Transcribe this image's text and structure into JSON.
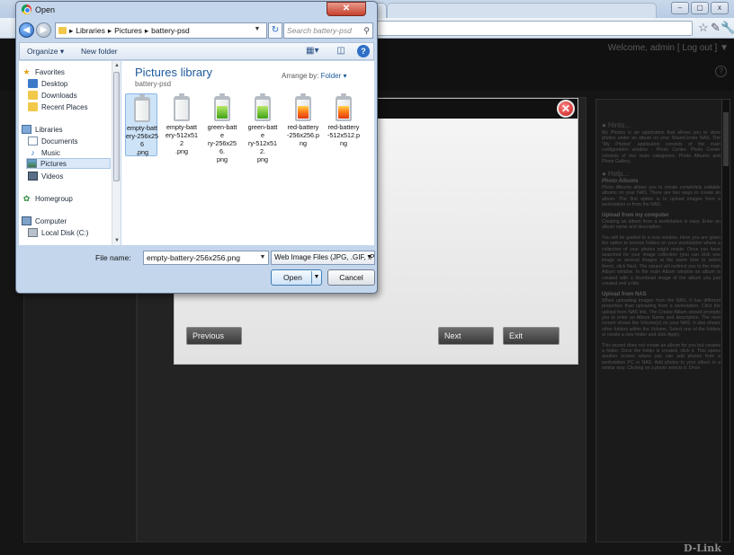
{
  "browser": {
    "welcome": "Welcome, admin [ Log out ] ▼",
    "star_icon": "☆",
    "wrench_icon": "🔧",
    "pencil_icon": "✎",
    "help_icon": "?"
  },
  "wizard": {
    "previous_label": "Previous",
    "next_label": "Next",
    "exit_label": "Exit",
    "close_icon": "✕"
  },
  "hints": {
    "hints_title": "● Hints...",
    "hints_text": "My Photos is an application that allows you to store photos under an album on your ShareCenter NAS. The \"My Photos\" application consists of the main configuration window - Photo Center. Photo Center consists of two main categories: Photo Albums and Photo Gallery.",
    "help_title": "● Help...",
    "albums_title": "Photo Albums",
    "albums_text": "Photo Albums allows you to create completely editable albums on your NAS. There are two ways to create an album. The first option is to upload images from a workstation or from the NAS.",
    "upload_pc_title": "Upload from my computer",
    "upload_pc_text": "Creating an album from a workstation is easy. Enter an album name and description.",
    "guide_text": "You will be guided to a new window. Here you are given the option to browse folders on your workstation where a collection of your photos might reside. Once you have searched for your image collection (you can click one image or several images at the same time to select them), click Next. The wizard will redirect you to the main Album window. In the main Album window an album is created with a thumbnail image of the album you just created and a title.",
    "upload_nas_title": "Upload from NAS",
    "upload_nas_text": "When uploading images from the NAS, it has different properties than uploading from a workstation. Click the upload from NAS link. The Create Album wizard prompts you to enter an Album Name and description. The next screen shows the Volume(s) on your NAS. It also shows other folders within the Volume. Select one of the folders or create a new folder and click Apply.",
    "wizard_text": "This wizard does not create an album for you but creates a folder. Once the folder is created, click it. This opens another screen where you can add photos from a workstation PC or NAS. Add photos to your album in a similar way. Clicking on a photo selects it. Once"
  },
  "brand": "D-Link",
  "dialog": {
    "title": "Open",
    "close_icon": "✕",
    "breadcrumb": [
      "Libraries",
      "Pictures",
      "battery-psd"
    ],
    "search_placeholder": "Search battery-psd",
    "organize_label": "Organize ▾",
    "new_folder_label": "New folder",
    "nav": {
      "favorites": "Favorites",
      "desktop": "Desktop",
      "downloads": "Downloads",
      "recent": "Recent Places",
      "libraries": "Libraries",
      "documents": "Documents",
      "music": "Music",
      "pictures": "Pictures",
      "videos": "Videos",
      "homegroup": "Homegroup",
      "computer": "Computer",
      "local_disk": "Local Disk (C:)"
    },
    "library_title": "Pictures library",
    "library_subtitle": "battery-psd",
    "arrange_label": "Arrange by:",
    "arrange_value": "Folder ▾",
    "files": [
      {
        "name": "empty-battery-256x256.png",
        "lines": [
          "empty-batt",
          "ery-256x256",
          ".png"
        ],
        "kind": "empty",
        "selected": true
      },
      {
        "name": "empty-battery-512x512.png",
        "lines": [
          "empty-batt",
          "ery-512x512",
          ".png"
        ],
        "kind": "empty",
        "selected": false
      },
      {
        "name": "green-battery-256x256.png",
        "lines": [
          "green-batte",
          "ry-256x256.",
          "png"
        ],
        "kind": "green",
        "selected": false
      },
      {
        "name": "green-battery-512x512.png",
        "lines": [
          "green-batte",
          "ry-512x512.",
          "png"
        ],
        "kind": "green",
        "selected": false
      },
      {
        "name": "red-battery-256x256.png",
        "lines": [
          "red-battery",
          "-256x256.p",
          "ng"
        ],
        "kind": "red",
        "selected": false
      },
      {
        "name": "red-battery-512x512.png",
        "lines": [
          "red-battery",
          "-512x512.p",
          "ng"
        ],
        "kind": "red",
        "selected": false
      }
    ],
    "file_name_label": "File name:",
    "file_name_value": "empty-battery-256x256.png",
    "file_type_value": "Web Image Files (JPG, .GIF, .PN",
    "open_label": "Open",
    "cancel_label": "Cancel"
  }
}
